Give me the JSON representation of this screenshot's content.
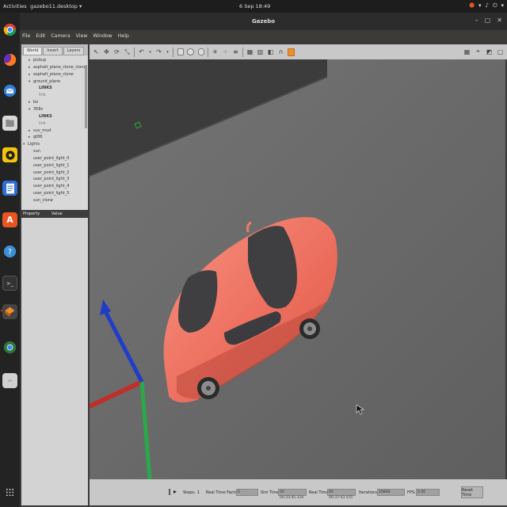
{
  "topbar": {
    "activities": "Activities",
    "app_name": "gazebo11.desktop ▾",
    "clock": "6 Sep 18:49",
    "tray": [
      "⬤",
      "▾",
      "♪",
      "⏻",
      "▾"
    ]
  },
  "dock": {
    "items": [
      "chrome-icon",
      "firefox-icon",
      "thunderbird-icon",
      "files-icon",
      "rhythmbox-icon",
      "writer-icon",
      "app-center-icon",
      "help-icon",
      "terminal-icon",
      "gazebo-icon",
      "chrome-icon-2",
      "disk-icon",
      "apps-grid-icon"
    ]
  },
  "window": {
    "title": "Gazebo",
    "controls": [
      "–",
      "▢",
      "✕"
    ],
    "menu": [
      "File",
      "Edit",
      "Camera",
      "View",
      "Window",
      "Help"
    ]
  },
  "left_panel": {
    "tabs": [
      "World",
      "Insert",
      "Layers"
    ],
    "tree": [
      {
        "label": "pickup",
        "arrow": "▸"
      },
      {
        "label": "asphalt_plane_clone_clone",
        "arrow": "▸"
      },
      {
        "label": "asphalt_plane_clone",
        "arrow": "▸"
      },
      {
        "label": "ground_plane",
        "arrow": "▾"
      },
      {
        "label": "LINKS",
        "arrow": ""
      },
      {
        "label": "link",
        "arrow": ""
      },
      {
        "label": "bo",
        "arrow": "▸"
      },
      {
        "label": "358z",
        "arrow": "▾"
      },
      {
        "label": "LINKS",
        "arrow": ""
      },
      {
        "label": "link",
        "arrow": ""
      },
      {
        "label": "suv_mud",
        "arrow": "▸"
      },
      {
        "label": "gt86",
        "arrow": "▸"
      },
      {
        "label": "Lights",
        "arrow": "▾"
      },
      {
        "label": "sun",
        "arrow": ""
      },
      {
        "label": "user_point_light_0",
        "arrow": ""
      },
      {
        "label": "user_point_light_1",
        "arrow": ""
      },
      {
        "label": "user_point_light_2",
        "arrow": ""
      },
      {
        "label": "user_point_light_3",
        "arrow": ""
      },
      {
        "label": "user_point_light_4",
        "arrow": ""
      },
      {
        "label": "user_point_light_5",
        "arrow": ""
      },
      {
        "label": "sun_clone",
        "arrow": ""
      }
    ],
    "property_header": "Property",
    "value_header": "Value"
  },
  "toolbar": {
    "tools": [
      "↖",
      "✥",
      "⟳",
      "⤡",
      "↶",
      "▾",
      "↷",
      "▾",
      "●",
      "■",
      "◆",
      "✳",
      "⁘",
      "≡",
      "▦",
      "▥",
      "◧",
      "∩",
      "▣"
    ],
    "right_tools": [
      "▦",
      "⌖",
      "◩",
      "▢"
    ]
  },
  "bottom": {
    "pause": "‖",
    "step_label": "Steps:",
    "step_value": "1",
    "rtf_label": "Real Time Factor:",
    "rtf_value": "0",
    "sim_time_label": "Sim Time:",
    "sim_time_value": "00 00:33:45.334",
    "real_time_label": "Real Time:",
    "real_time_value": "00 00:37:43.555",
    "iterations_label": "Iterations:",
    "iterations_value": "29898",
    "fps_label": "FPS:",
    "fps_value": "5.00",
    "reset_label": "Reset Time"
  },
  "colors": {
    "car_body": "#f07a68",
    "axis_x": "#c0302b",
    "axis_y": "#2aa84a",
    "axis_z": "#1f3dc8",
    "accent": "#e95420"
  }
}
